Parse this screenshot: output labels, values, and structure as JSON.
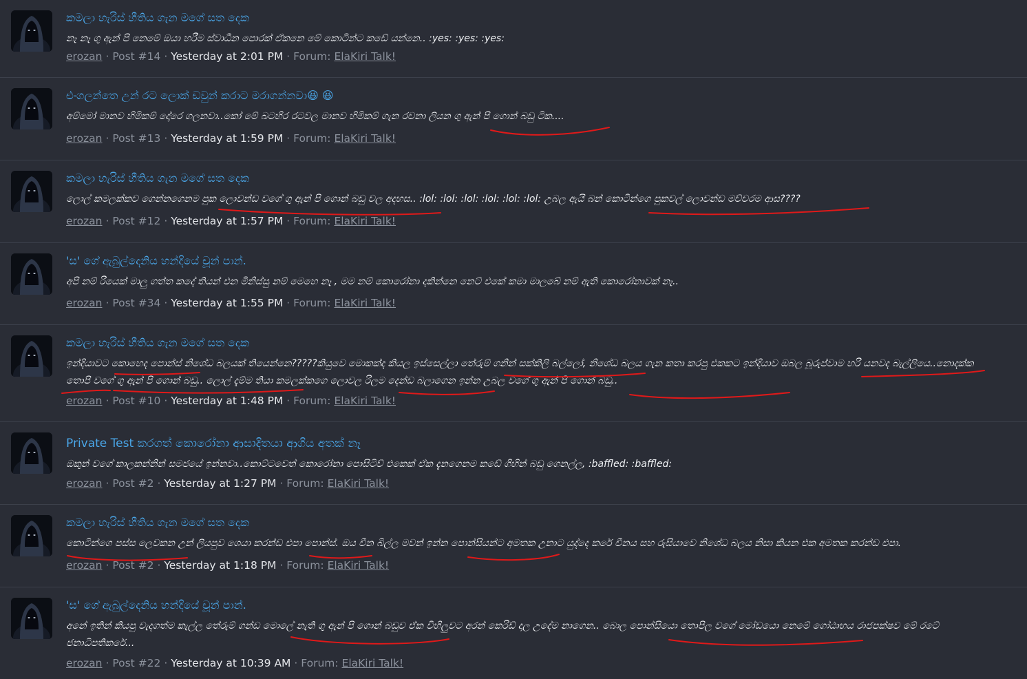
{
  "results": [
    {
      "title": "කමලා හැරිස් හීතිය ගැන මගේ සත දෙක",
      "snippet": "නෑ නෑ ගු ඇන් පි නෙමේ ඔයා හරීම ස්වාධීන පොරක් ඒකනෙ මේ කොටින්ට කඩේ යන්නෙ.. :yes: :yes: :yes:",
      "author": "erozan",
      "post": "Post #14",
      "time": "Yesterday at 2:01 PM",
      "forum_label": "Forum:",
      "forum": "ElaKiri Talk!"
    },
    {
      "title": "එංගලන්තෙ උන් රට ලොක් ඩවුන් කරාට මරාගන්නවා😆 😆",
      "snippet": "අම්මෝ මානව හිමිකම් දෝරෙ ගලනවා..කෝ මේ බටහිර රටවල මානව හිමිකම් ගැන රචනා ලියන ගු ඇන් පි ගොන් බඩු ටික....",
      "author": "erozan",
      "post": "Post #13",
      "time": "Yesterday at 1:59 PM",
      "forum_label": "Forum:",
      "forum": "ElaKiri Talk!"
    },
    {
      "title": "කමලා හැරිස් හීතිය ගැන මගේ සත දෙක",
      "snippet": "ලොල් කමලක්කව ගෙන්නගෙනම පුක ලොවන්ඩ වගේ ගු ඇන් පි ගොන් බඩු වල අදහස.. :lol: :lol: :lol: :lol: :lol: :lol: උබල ඇයි බන් කොටින්ගෙ පුකවල් ලොවන්ඩ මච්චරම ආස????",
      "author": "erozan",
      "post": "Post #12",
      "time": "Yesterday at 1:57 PM",
      "forum_label": "Forum:",
      "forum": "ElaKiri Talk!"
    },
    {
      "title": "'ස' ගේ ඇබුල්දෙනිය හන්දියේ චූන් පාන්.",
      "snippet": "අපි නම් රියෙක් මාලු ගත්ත කදේ තියන් එන මිනිස්සු නම් මෙහෙ නෑ , මම නම් කොරෝනා දකින්නෙ නෙට් එකේ කමා මාලබේ නම් ඇති කොරෝනාවක් නෑ..",
      "author": "erozan",
      "post": "Post #34",
      "time": "Yesterday at 1:55 PM",
      "forum_label": "Forum:",
      "forum": "ElaKiri Talk!"
    },
    {
      "title": "කමලා හැරිස් හීතිය ගැන මගේ සත දෙක",
      "snippet": "ඉන්දියාවට කොහෙද පොන්ස් නිශේධ බලයක් තියෙන්නෙ?????කියුවෙ මොකක්ද කියල ඉස්සෙල්ලා තේරුම් ගනින් සක්කිලි බල්ලෝ, නිශේධ බලය ගැන කතා කරපු එකකට ඉන්දියාව ඔබල බූරුප්වාම හරි යනවද බැල්ලියෙ..නොදක්ක තොපි වගේ ගු ඇන් පි ගොන් බඩු.. ලොල් දැම්ම තියා කමලක්කගෙ ලොවල රිලම දෙන්ඩ බලාගෙන ඉන්න උබල වගේ ගු ඇන් පි ගොන් බඩු..",
      "author": "erozan",
      "post": "Post #10",
      "time": "Yesterday at 1:48 PM",
      "forum_label": "Forum:",
      "forum": "ElaKiri Talk!"
    },
    {
      "title": "Private Test කරගත් කොරෝනා ආසාදිතයා ආගිය අතක් නෑ",
      "snippet": "ඔකුන් වගේ කාලකන්නින් සමජයේ ඉන්නවා..කොට්ටවෙත් කොරෝනා පොසිටිව් එකෙක් ඒක දැනගෙනම කඩේ ගිහින් බඩු ගෙනල්ල, :baffled: :baffled:",
      "author": "erozan",
      "post": "Post #2",
      "time": "Yesterday at 1:27 PM",
      "forum_label": "Forum:",
      "forum": "ElaKiri Talk!"
    },
    {
      "title": "කමලා හැරිස් හීතිය ගැන මගේ සත දෙක",
      "snippet": "කොටින්ගෙ පස්ස ලෙවකන උන් ලියපුව ශෙයා කරන්ඩ එපා පොන්ස්. ඔය චීන බිල්ල මවන් ඉන්න පොන්සියන්ට අමතක උනාට යුද්දෙ කරේ චීනය සහ රුසියාවෙ නිශේධ බලය නිසා කියන එක අමතක කරන්ඩ එපා.",
      "author": "erozan",
      "post": "Post #2",
      "time": "Yesterday at 1:18 PM",
      "forum_label": "Forum:",
      "forum": "ElaKiri Talk!"
    },
    {
      "title": "'ස' ගේ ඇබුල්දෙනිය හන්දියේ චූන් පාන්.",
      "snippet": "අනේ ඉතින් කියපු වැදගත්ම කැල්ල තේරුම් ගන්ඩ මොලේ නැති ගු ඇන් පි ගොන් බඩුව ඒක විහිලුවට අරන් කෙරිඩ් දාල උදේම නාගෙන.. බොල පොන්සියො තොපිල වගේ මෝඩයො නෙමේ ගෝඨාභය රාජපක්ෂව මේ රටේ ජනාධිපතිකරේ...",
      "author": "erozan",
      "post": "Post #22",
      "time": "Yesterday at 10:39 AM",
      "forum_label": "Forum:",
      "forum": "ElaKiri Talk!"
    }
  ],
  "annotation_color": "#e01919",
  "icons": {
    "avatar": "hooded-figure-avatar-icon"
  }
}
